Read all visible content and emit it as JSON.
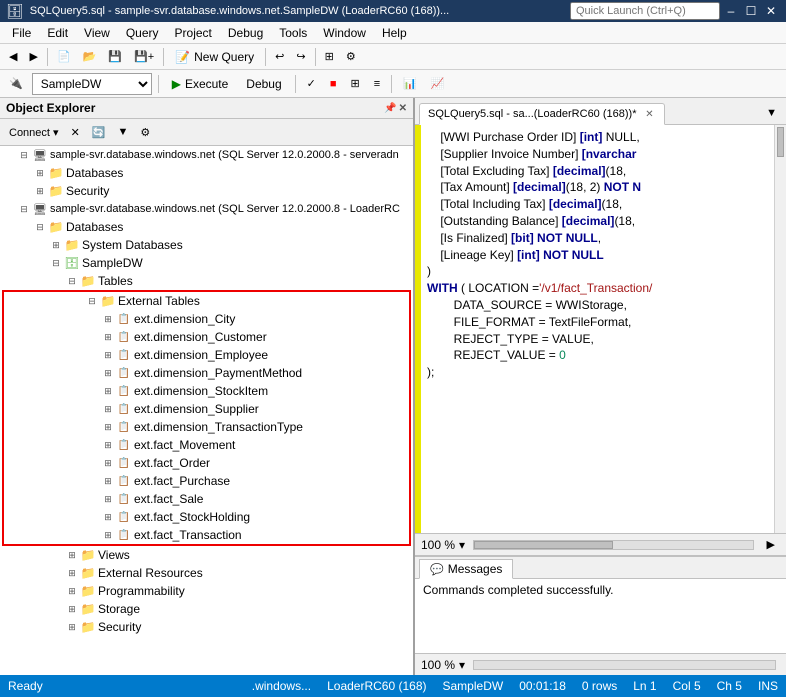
{
  "titleBar": {
    "title": "SQLQuery5.sql - sample-svr.database.windows.net.SampleDW (LoaderRC60 (168))...",
    "searchPlaceholder": "Quick Launch (Ctrl+Q)",
    "minBtn": "–",
    "maxBtn": "☐",
    "closeBtn": "✕"
  },
  "menuBar": {
    "items": [
      "File",
      "Edit",
      "View",
      "Query",
      "Project",
      "Debug",
      "Tools",
      "Window",
      "Help"
    ]
  },
  "toolbar": {
    "newQueryLabel": "New Query",
    "dbLabel": "SampleDW",
    "executeLabel": "Execute",
    "debugLabel": "Debug"
  },
  "objectExplorer": {
    "title": "Object Explorer",
    "connectBtn": "Connect ▾",
    "servers": [
      {
        "name": "sample-svr.database.windows.net (SQL Server 12.0.2000.8 - serveradn",
        "children": [
          {
            "name": "Databases"
          },
          {
            "name": "Security"
          }
        ]
      },
      {
        "name": "sample-svr.database.windows.net (SQL Server 12.0.2000.8 - LoaderRC",
        "children": [
          {
            "name": "Databases",
            "children": [
              {
                "name": "System Databases"
              },
              {
                "name": "SampleDW",
                "children": [
                  {
                    "name": "Tables",
                    "children": [
                      {
                        "name": "External Tables",
                        "highlighted": true,
                        "children": [
                          "ext.dimension_City",
                          "ext.dimension_Customer",
                          "ext.dimension_Employee",
                          "ext.dimension_PaymentMethod",
                          "ext.dimension_StockItem",
                          "ext.dimension_Supplier",
                          "ext.dimension_TransactionType",
                          "ext.fact_Movement",
                          "ext.fact_Order",
                          "ext.fact_Purchase",
                          "ext.fact_Sale",
                          "ext.fact_StockHolding",
                          "ext.fact_Transaction"
                        ]
                      }
                    ]
                  },
                  {
                    "name": "Views"
                  },
                  {
                    "name": "External Resources"
                  },
                  {
                    "name": "Programmability"
                  },
                  {
                    "name": "Storage"
                  },
                  {
                    "name": "Security"
                  }
                ]
              }
            ]
          }
        ]
      }
    ]
  },
  "codeTab": {
    "label": "SQLQuery5.sql - sa...(LoaderRC60 (168))*",
    "code": "    [WWI Purchase Order ID] [int] NULL,\n    [Supplier Invoice Number] [nvarchar\n    [Total Excluding Tax] [decimal](18,\n    [Tax Amount] [decimal](18, 2) NOT N\n    [Total Including Tax] [decimal](18,\n    [Outstanding Balance] [decimal](18,\n    [Is Finalized] [bit] NOT NULL,\n    [Lineage Key] [int] NOT NULL\n)\nWITH ( LOCATION ='/v1/fact_Transaction/\n        DATA_SOURCE = WWIStorage,\n        FILE_FORMAT = TextFileFormat,\n        REJECT_TYPE = VALUE,\n        REJECT_VALUE = 0\n);"
  },
  "zoomBar": {
    "zoom": "100 %"
  },
  "messagesPanel": {
    "tabLabel": "Messages",
    "content": "Commands completed successfully."
  },
  "statusBar": {
    "leftText": "Ready",
    "server": ".windows...",
    "user": "LoaderRC60 (168)",
    "db": "SampleDW",
    "time": "00:01:18",
    "rows": "0 rows",
    "position": {
      "ln": "Ln 1",
      "col": "Col 5",
      "ch": "Ch 5",
      "mode": "INS"
    }
  }
}
